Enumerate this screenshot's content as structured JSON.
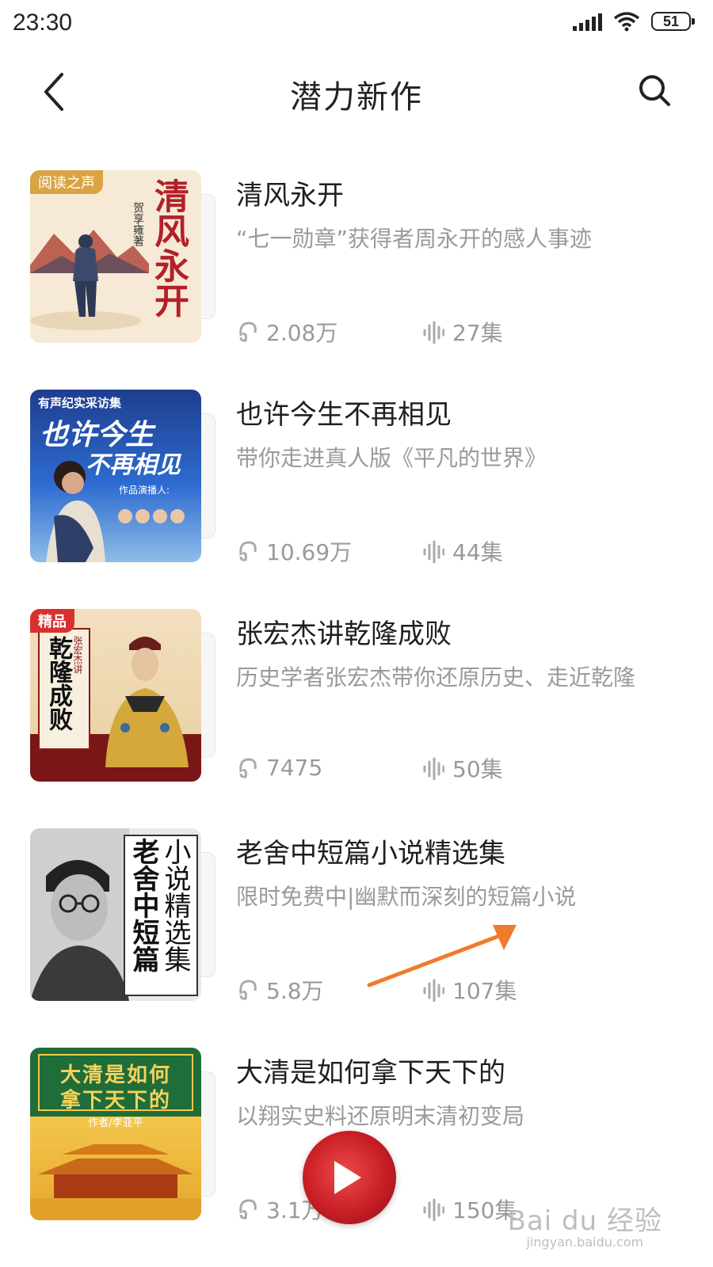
{
  "status_bar": {
    "time": "23:30",
    "battery": "51"
  },
  "header": {
    "title": "潜力新作"
  },
  "items": [
    {
      "title": "清风永开",
      "description": "“七一勋章”获得者周永开的感人事迹",
      "plays": "2.08万",
      "episodes": "27集",
      "cover": {
        "tag": "阅读之声",
        "big_text": "清风永开",
        "author": "贺享雍著"
      }
    },
    {
      "title": "也许今生不再相见",
      "description": "带你走进真人版《平凡的世界》",
      "plays": "10.69万",
      "episodes": "44集",
      "cover": {
        "tag": "有声纪实采访集",
        "big_text": "也许今生",
        "big_text2": "不再相见",
        "caption": "作品演播人:"
      }
    },
    {
      "title": "张宏杰讲乾隆成败",
      "description": "历史学者张宏杰带你还原历史、走近乾隆",
      "plays": "7475",
      "episodes": "50集",
      "cover": {
        "tag": "精品",
        "big_text": "乾隆成败",
        "author": "张宏杰讲"
      }
    },
    {
      "title": "老舍中短篇小说精选集",
      "description": "限时免费中|幽默而深刻的短篇小说",
      "plays": "5.8万",
      "episodes": "107集",
      "cover": {
        "big_text": "老舍中短篇",
        "big_text2": "小说精选集"
      }
    },
    {
      "title": "大清是如何拿下天下的",
      "description": "以翔实史料还原明末清初变局",
      "plays": "3.1万",
      "episodes": "150集",
      "cover": {
        "line1": "大清是如何",
        "line2": "拿下天下的",
        "author": "作者/李亚平"
      }
    }
  ],
  "watermark": {
    "line1": "Bai du 经验",
    "line2": "jingyan.baidu.com"
  },
  "colors": {
    "accent_arrow": "#f07b2a",
    "player_red": "#c81e26",
    "muted_text": "#9a9a9a"
  },
  "icons": [
    "back-icon",
    "search-icon",
    "headphone-icon",
    "audio-wave-icon",
    "play-icon"
  ]
}
